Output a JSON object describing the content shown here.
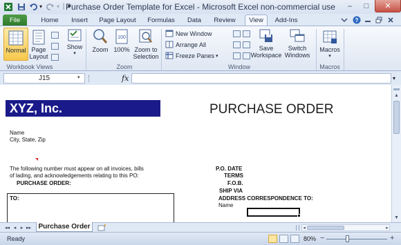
{
  "window": {
    "title": "Purchase Order Template for Excel  -  Microsoft Excel non-commercial use",
    "minimize": "–",
    "maximize": "□",
    "close": "✕"
  },
  "quick_access": {
    "separator": "|",
    "customize": "▾"
  },
  "tabs": [
    "File",
    "Home",
    "Insert",
    "Page Layout",
    "Formulas",
    "Data",
    "Review",
    "View",
    "Add-Ins"
  ],
  "active_tab": "View",
  "ribbon": {
    "workbook_views": {
      "label": "Workbook Views",
      "normal": "Normal",
      "page_layout": [
        "Page",
        "Layout"
      ],
      "show": "Show"
    },
    "zoom": {
      "label": "Zoom",
      "zoom": "Zoom",
      "hundred": "100%",
      "zoom_to_selection": [
        "Zoom to",
        "Selection"
      ]
    },
    "window": {
      "label": "Window",
      "new_window": "New Window",
      "arrange_all": "Arrange All",
      "freeze_panes": "Freeze Panes",
      "save_workspace": [
        "Save",
        "Workspace"
      ],
      "switch_windows": [
        "Switch",
        "Windows"
      ]
    },
    "macros": {
      "label": "Macros",
      "macros": "Macros"
    }
  },
  "formula_bar": {
    "name_box": "J15",
    "fx": "fx",
    "formula": ""
  },
  "sheet": {
    "company": "XYZ, Inc.",
    "heading": "PURCHASE ORDER",
    "address": [
      "Name",
      "City, State, Zip"
    ],
    "notice": [
      "The following number must appear on all invoices, bills",
      "of lading, and acknowledgements relating to this PO:"
    ],
    "po_label": "PURCHASE ORDER:",
    "to_label": "TO:",
    "po_fields": [
      "P.O. DATE",
      "TERMS",
      "F.O.B.",
      "SHIP VIA"
    ],
    "address_corr": "ADDRESS CORRESPONDENCE TO:",
    "corr_name": "Name"
  },
  "sheet_tabs": {
    "active": "Purchase Order",
    "nav": [
      "◂◂",
      "◂",
      "▸",
      "▸▸"
    ]
  },
  "status": {
    "ready": "Ready",
    "zoom": "80%",
    "zoom_out": "−",
    "zoom_in": "+"
  },
  "colors": {
    "company_banner": "#1a1a8a",
    "file_tab": "#2d7a2a",
    "ribbon_bg": "#dfe7f3"
  }
}
